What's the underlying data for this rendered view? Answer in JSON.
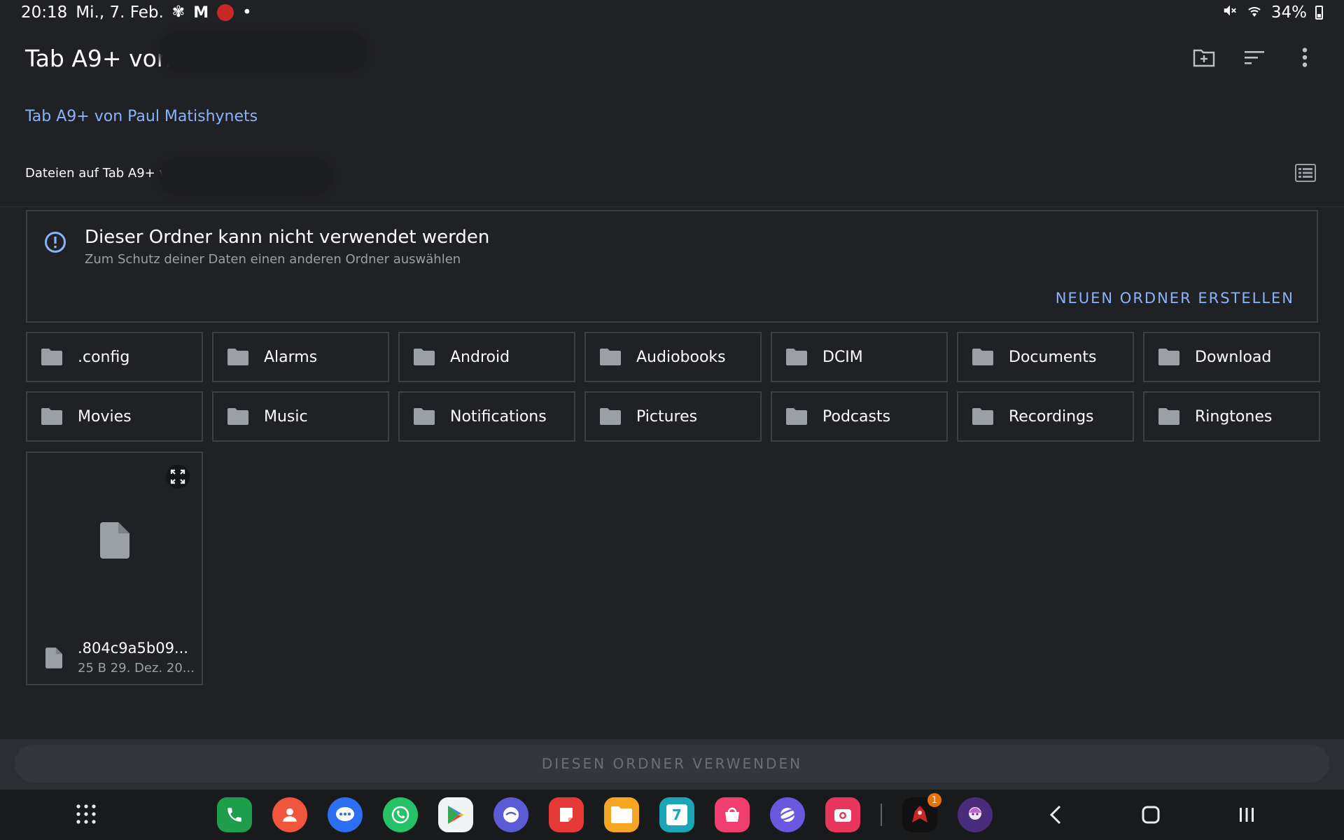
{
  "status_bar": {
    "time": "20:18",
    "date": "Mi., 7. Feb.",
    "dot": "•",
    "battery": "34%"
  },
  "app_bar": {
    "title": "Tab A9+ von P"
  },
  "breadcrumb": "Tab A9+ von Paul Matishynets",
  "subheader": "Dateien auf Tab A9+ vo",
  "banner": {
    "title": "Dieser Ordner kann nicht verwendet werden",
    "subtitle": "Zum Schutz deiner Daten einen anderen Ordner auswählen",
    "action": "NEUEN ORDNER ERSTELLEN"
  },
  "folders": [
    ".config",
    "Alarms",
    "Android",
    "Audiobooks",
    "DCIM",
    "Documents",
    "Download",
    "Movies",
    "Music",
    "Notifications",
    "Pictures",
    "Podcasts",
    "Recordings",
    "Ringtones"
  ],
  "file": {
    "name": ".804c9a5b09...",
    "info": "25 B 29. Dez. 20..."
  },
  "bottom_button": "DIESEN ORDNER VERWENDEN",
  "dock": {
    "calendar_day": "7",
    "badge_count": "1"
  },
  "colors": {
    "background": "#202124",
    "accent": "#8ab4f8",
    "border": "#3c4043"
  }
}
